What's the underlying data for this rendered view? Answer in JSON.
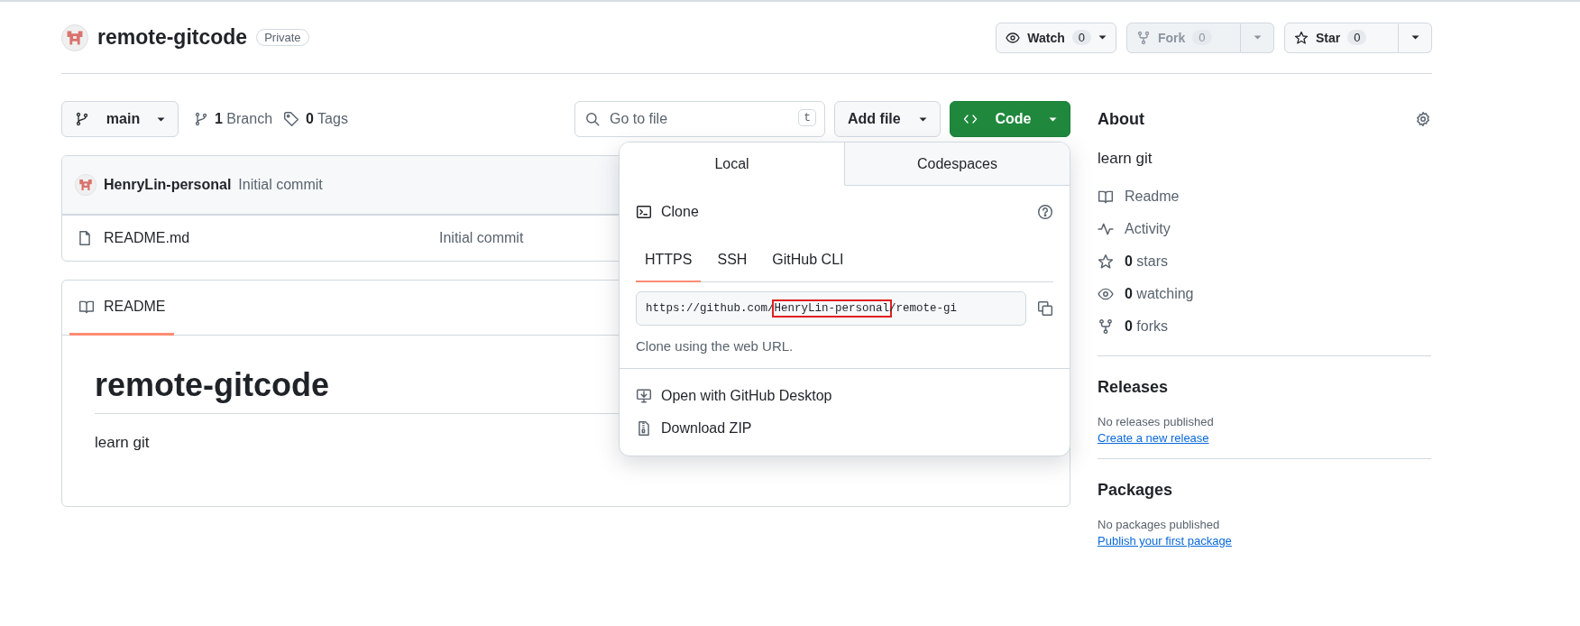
{
  "repo": {
    "name": "remote-gitcode",
    "visibility": "Private"
  },
  "header_actions": [
    {
      "kind": "menu",
      "label": "Watch",
      "count": "0",
      "disabled": false
    },
    {
      "kind": "split",
      "label": "Fork",
      "count": "0",
      "disabled": true
    },
    {
      "kind": "split",
      "label": "Star",
      "count": "0",
      "disabled": false
    }
  ],
  "toolbar": {
    "branch": "main",
    "branches": {
      "count": "1",
      "label": "Branch"
    },
    "tags": {
      "count": "0",
      "label": "Tags"
    },
    "search": {
      "placeholder": "Go to file",
      "shortcut": "t"
    },
    "add_file": "Add file",
    "code": "Code"
  },
  "latest_commit": {
    "author": "HenryLin-personal",
    "message": "Initial commit"
  },
  "files": [
    {
      "name": "README.md",
      "commit": "Initial commit"
    }
  ],
  "readme": {
    "tab": {
      "label": "README",
      "selected": true
    },
    "heading": "remote-gitcode",
    "body": "learn git"
  },
  "clone_menu": {
    "tabs": [
      {
        "label": "Local",
        "selected": true
      },
      {
        "label": "Codespaces",
        "selected": false
      }
    ],
    "title": "Clone",
    "protocols": [
      {
        "label": "HTTPS",
        "selected": true
      },
      {
        "label": "SSH",
        "selected": false
      },
      {
        "label": "GitHub CLI",
        "selected": false
      }
    ],
    "url": {
      "before": "https://github.com/",
      "highlighted": "HenryLin-personal",
      "after": "/remote-gi"
    },
    "hint": "Clone using the web URL.",
    "actions": [
      {
        "kind": "desktop",
        "label": "Open with GitHub Desktop"
      },
      {
        "kind": "zip",
        "label": "Download ZIP"
      }
    ]
  },
  "about": {
    "title": "About",
    "description": "learn git",
    "links": [
      {
        "kind": "readme",
        "label": "Readme"
      },
      {
        "kind": "activity",
        "label": "Activity"
      },
      {
        "kind": "stars",
        "count": "0",
        "label": "stars"
      },
      {
        "kind": "watching",
        "count": "0",
        "label": "watching"
      },
      {
        "kind": "forks",
        "count": "0",
        "label": "forks"
      }
    ]
  },
  "releases": {
    "title": "Releases",
    "empty": "No releases published",
    "link": "Create a new release"
  },
  "packages": {
    "title": "Packages",
    "empty": "No packages published",
    "link": "Publish your first package"
  }
}
